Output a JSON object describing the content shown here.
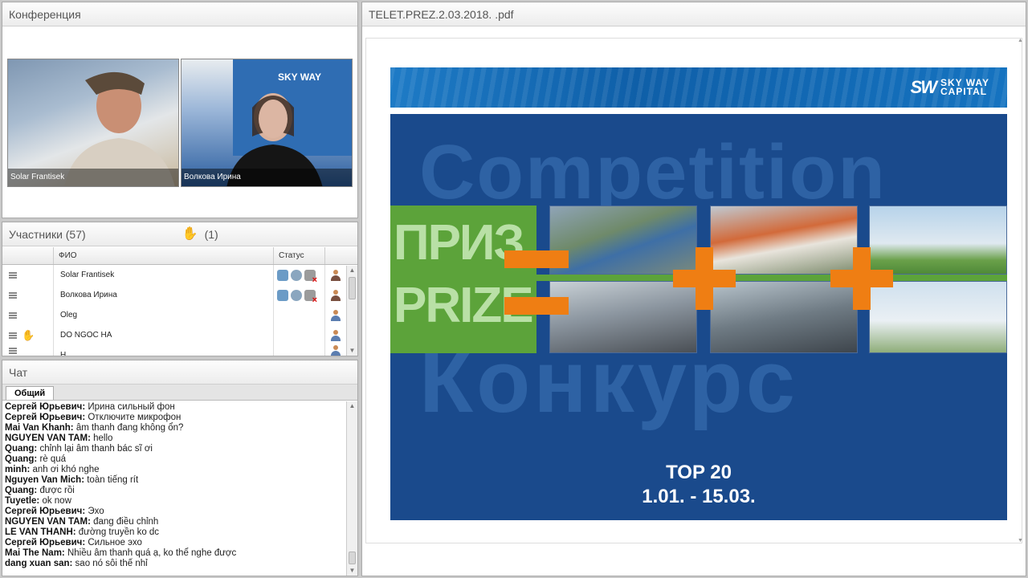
{
  "video_pod": {
    "title": "Конференция",
    "feeds": [
      {
        "name": "Solar Frantisek"
      },
      {
        "name": "Волкова Ирина"
      }
    ]
  },
  "participants_pod": {
    "title": "Участники (57)",
    "raised_hands": "(1)",
    "columns": [
      "ФИО",
      "Статус"
    ],
    "rows": [
      {
        "name": "Solar Frantisek",
        "hand": false,
        "status_icons": [
          "webcam-icon",
          "microphone-icon",
          "camera-off-icon"
        ],
        "role": "host"
      },
      {
        "name": "Волкова Ирина",
        "hand": false,
        "status_icons": [
          "webcam-icon",
          "microphone-icon",
          "camera-off-icon"
        ],
        "role": "host"
      },
      {
        "name": "Oleg",
        "hand": false,
        "status_icons": [],
        "role": "participant"
      },
      {
        "name": "DO NGOC HA",
        "hand": true,
        "status_icons": [],
        "role": "participant"
      },
      {
        "name": "H",
        "hand": false,
        "status_icons": [],
        "role": "participant"
      }
    ]
  },
  "chat_pod": {
    "title": "Чат",
    "tab": "Общий",
    "messages": [
      {
        "author": "Сергей Юрьевич:",
        "text": " Ирина сильный фон"
      },
      {
        "author": "Сергей Юрьевич:",
        "text": " Отключите микрофон"
      },
      {
        "author": "Mai Van Khanh:",
        "text": " âm thanh đang không ổn?"
      },
      {
        "author": "NGUYEN VAN TAM:",
        "text": " hello"
      },
      {
        "author": "Quang:",
        "text": " chỉnh lại âm thanh bác sĩ ơi"
      },
      {
        "author": "Quang:",
        "text": " rè quá"
      },
      {
        "author": "minh:",
        "text": " anh ơi khó nghe"
      },
      {
        "author": "Nguyen Van Mich:",
        "text": " toàn tiếng rít"
      },
      {
        "author": "Quang:",
        "text": " được rồi"
      },
      {
        "author": "Tuyetle:",
        "text": " ok now"
      },
      {
        "author": "Сергей Юрьевич:",
        "text": " Эхо"
      },
      {
        "author": "NGUYEN VAN TAM:",
        "text": " đang điều chỉnh"
      },
      {
        "author": "LE VAN THANH:",
        "text": " đường truyền ko dc"
      },
      {
        "author": "Сергей Юрьевич:",
        "text": " Сильное эхо"
      },
      {
        "author": "Mai The Nam:",
        "text": " Nhiều âm thanh quá ạ, ko thể nghe được"
      },
      {
        "author": "dang xuan san:",
        "text": " sao nó sôi thế nhỉ"
      }
    ]
  },
  "document_pod": {
    "title": "TELET.PREZ.2.03.2018. .pdf",
    "slide": {
      "logo_mark": "SW",
      "logo_line1": "SKY WAY",
      "logo_line2": "CAPITAL",
      "bg_word_1": "Competition",
      "bg_word_2": "Конкурс",
      "prize_ru": "ПРИЗ",
      "prize_en": "PRIZE",
      "headline": "TOP 20",
      "dates": "1.01. - 15.03."
    }
  },
  "colors": {
    "slide_blue": "#1a4a8c",
    "header_blue": "#1573c0",
    "accent_orange": "#ef7e13",
    "accent_green": "#5ca33a"
  }
}
